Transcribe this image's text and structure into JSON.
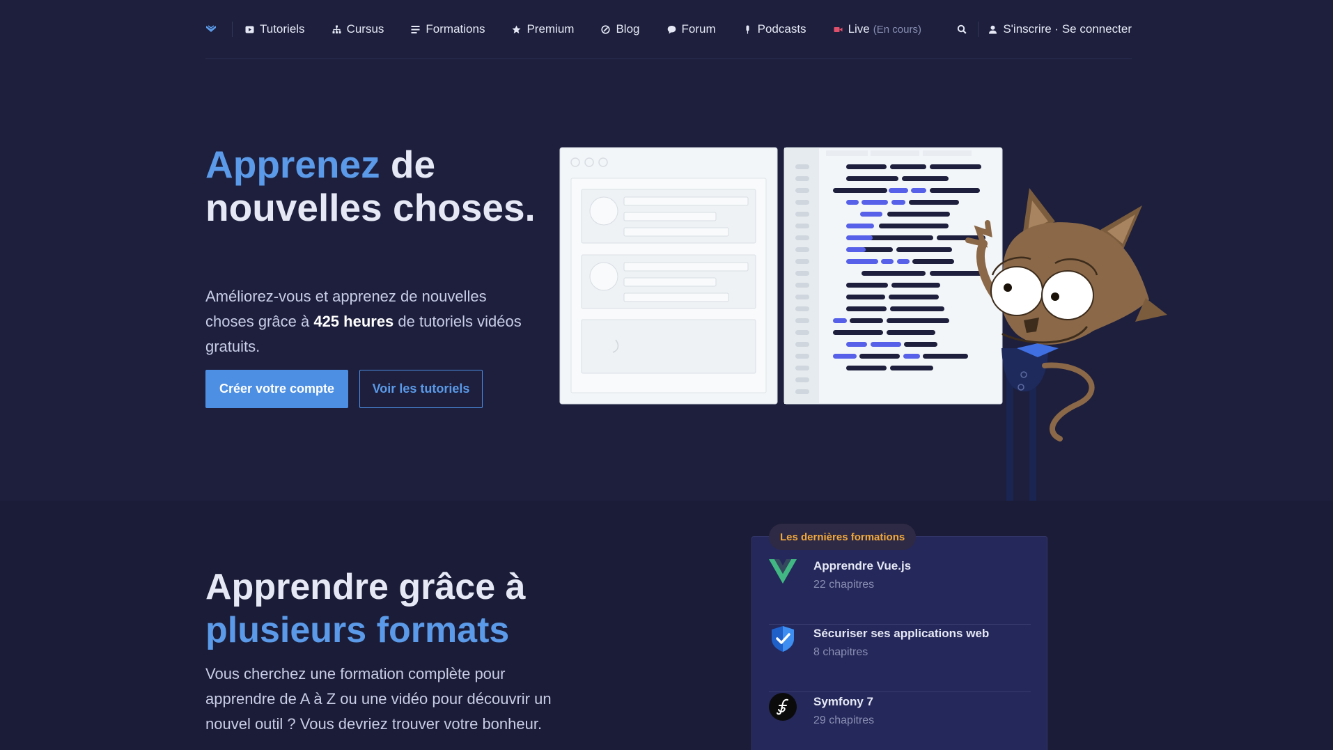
{
  "nav": {
    "items": [
      {
        "label": "Tutoriels",
        "icon": "play-icon"
      },
      {
        "label": "Cursus",
        "icon": "tree-icon"
      },
      {
        "label": "Formations",
        "icon": "list-icon"
      },
      {
        "label": "Premium",
        "icon": "star-icon"
      },
      {
        "label": "Blog",
        "icon": "pen-icon"
      },
      {
        "label": "Forum",
        "icon": "chat-icon"
      },
      {
        "label": "Podcasts",
        "icon": "mic-icon"
      },
      {
        "label": "Live",
        "icon": "video-icon",
        "status": "(En cours)"
      }
    ],
    "account": "S'inscrire · Se connecter"
  },
  "hero": {
    "title_accent": "Apprenez",
    "title_rest": "de nouvelles choses.",
    "text_before": "Améliorez-vous et apprenez de nouvelles choses grâce à",
    "text_bold": "425 heures",
    "text_after": "de tutoriels vidéos gratuits.",
    "primary_button": "Créer votre compte",
    "secondary_button": "Voir les tutoriels"
  },
  "formats": {
    "title_line1": "Apprendre grâce à",
    "title_accent": "plusieurs formats",
    "text": "Vous cherchez une formation complète pour apprendre de A à Z ou une vidéo pour découvrir un nouvel outil ? Vous devriez trouver votre bonheur."
  },
  "latest": {
    "badge": "Les dernières formations",
    "courses": [
      {
        "name": "Apprendre Vue.js",
        "meta": "22 chapitres",
        "icon": "vue-icon"
      },
      {
        "name": "Sécuriser ses applications web",
        "meta": "8 chapitres",
        "icon": "shield-check-icon"
      },
      {
        "name": "Symfony 7",
        "meta": "29 chapitres",
        "icon": "symfony-icon"
      }
    ]
  },
  "colors": {
    "background": "#1d1f3d",
    "accent": "#5b9ae8",
    "badge_text": "#f2a93b",
    "live_icon": "#e0506a"
  }
}
